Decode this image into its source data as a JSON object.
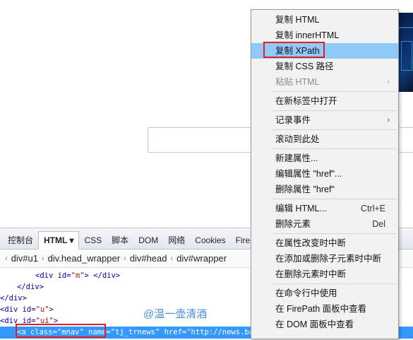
{
  "devtools": {
    "tabs": [
      "控制台",
      "HTML ▾",
      "CSS",
      "脚本",
      "DOM",
      "网络",
      "Cookies",
      "Fire"
    ],
    "breadcrumbs": [
      "div#u1",
      "div.head_wrapper",
      "div#head",
      "div#wrapper"
    ],
    "tree": {
      "l1_open": "<div id=",
      "l1_val": "\"m\"",
      "l1_close": "> </div>",
      "l2": "</div>",
      "l3": "</div>",
      "l4_open": "<div id=",
      "l4_val": "\"u\"",
      "l4_close": ">",
      "l5_open": "<div id=",
      "l5_val": "\"ui\"",
      "l5_close": ">",
      "selected": "<a class=\"mnav\" name=\"tj_trnews\" href=\"http://news.baidu.com\" >"
    }
  },
  "watermark": "@温一壶清酒",
  "context_menu": {
    "items": [
      {
        "label": "复制 HTML"
      },
      {
        "label": "复制 innerHTML"
      },
      {
        "label": "复制 XPath"
      },
      {
        "label": "复制 CSS 路径"
      },
      {
        "label": "粘贴 HTML"
      },
      {
        "label": "在新标签中打开"
      },
      {
        "label": "记录事件"
      },
      {
        "label": "滚动到此处"
      },
      {
        "label": "新建属性..."
      },
      {
        "label": "编辑属性 \"href\"..."
      },
      {
        "label": "删除属性 \"href\""
      },
      {
        "label": "编辑 HTML...",
        "shortcut": "Ctrl+E"
      },
      {
        "label": "删除元素",
        "shortcut": "Del"
      },
      {
        "label": "在属性改变时中断"
      },
      {
        "label": "在添加或删除子元素时中断"
      },
      {
        "label": "在删除元素时中断"
      },
      {
        "label": "在命令行中使用"
      },
      {
        "label": "在 FirePath 面板中查看"
      },
      {
        "label": "在 DOM 面板中查看"
      }
    ],
    "arrow": "›"
  },
  "colors": {
    "menu_highlight": "#91c9f7",
    "annotation_box": "#e02020",
    "selected_row": "#3399ff"
  }
}
